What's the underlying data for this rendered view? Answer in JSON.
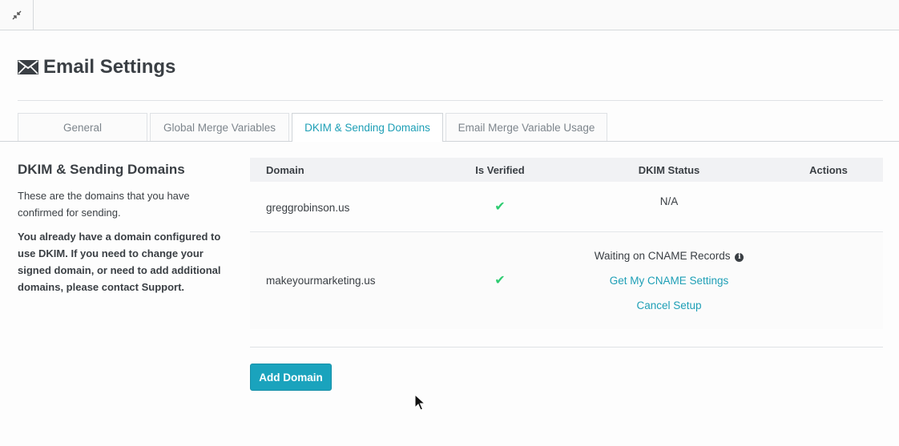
{
  "page": {
    "title": "Email Settings",
    "icon": "envelope-icon"
  },
  "topbar": {
    "collapse_icon": "collapse-arrows-icon"
  },
  "tabs": [
    {
      "label": "General",
      "active": false
    },
    {
      "label": "Global Merge Variables",
      "active": false
    },
    {
      "label": "DKIM & Sending Domains",
      "active": true
    },
    {
      "label": "Email Merge Variable Usage",
      "active": false
    }
  ],
  "left_panel": {
    "heading": "DKIM & Sending Domains",
    "description": "These are the domains that you have confirmed for sending.",
    "note": "You already have a domain configured to use DKIM. If you need to change your signed domain, or need to add additional domains, please contact Support."
  },
  "table": {
    "headers": {
      "domain": "Domain",
      "verified": "Is Verified",
      "dkim_status": "DKIM Status",
      "actions": "Actions"
    },
    "rows": [
      {
        "domain": "greggrobinson.us",
        "verified": true,
        "dkim_status": "N/A"
      },
      {
        "domain": "makeyourmarketing.us",
        "verified": true,
        "dkim_status": "Waiting on CNAME Records",
        "link_settings": "Get My CNAME Settings",
        "link_cancel": "Cancel Setup"
      }
    ]
  },
  "buttons": {
    "add_domain": "Add Domain"
  },
  "colors": {
    "accent": "#1e9fb6",
    "button": "#1aa3bd",
    "check": "#2ecc71",
    "text": "#3a3f44"
  }
}
